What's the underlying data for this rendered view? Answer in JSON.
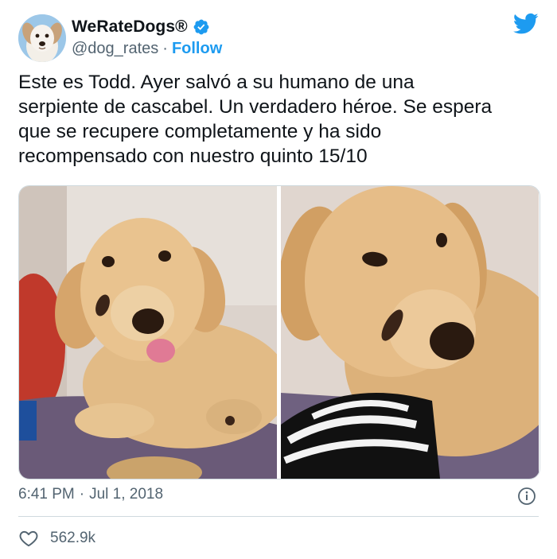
{
  "account": {
    "name": "WeRateDogs®",
    "handle": "@dog_rates",
    "separator": "·",
    "follow_label": "Follow",
    "verified_icon": "verified-badge-icon",
    "avatar_icon": "dog-avatar"
  },
  "brand": {
    "logo": "twitter-bird-icon",
    "accent": "#1d9bf0"
  },
  "tweet": {
    "text": "Este es Todd. Ayer salvó a su humano de una\nserpiente de cascabel. Un verdadero héroe. Se espera\nque se recupere completamente y ha sido\nrecompensado con nuestro quinto 15/10",
    "photos": [
      "golden-retriever-puppy-photo-1",
      "golden-retriever-puppy-photo-2"
    ],
    "time": "6:41 PM",
    "date_separator": "·",
    "date": "Jul 1, 2018",
    "info_icon": "info-icon"
  },
  "engagement": {
    "like_icon": "heart-icon",
    "like_count": "562.9k"
  }
}
